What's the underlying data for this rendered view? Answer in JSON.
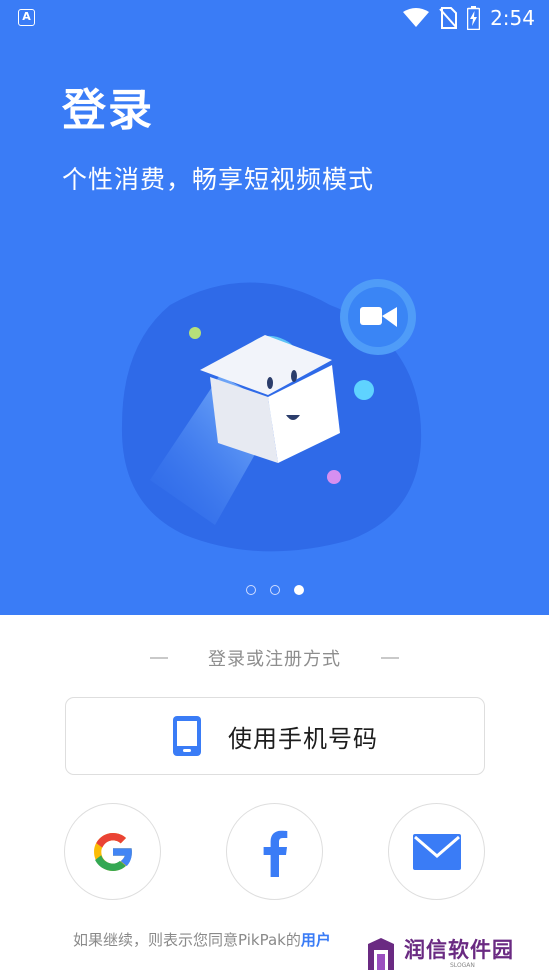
{
  "status_bar": {
    "app_letter": "A",
    "time": "2:54"
  },
  "hero": {
    "title": "登录",
    "subtitle": "个性消费，畅享短视频模式"
  },
  "carousel": {
    "page_count": 3,
    "active_index": 2
  },
  "login": {
    "divider_text": "登录或注册方式",
    "phone_button_label": "使用手机号码",
    "social_buttons": [
      "google",
      "facebook",
      "email"
    ]
  },
  "terms": {
    "text": "如果继续，则表示您同意PikPak的",
    "link_text": "用户"
  },
  "watermark": {
    "text": "润信软件园",
    "slogan": "SLOGAN"
  },
  "colors": {
    "primary_blue": "#3a7cf6",
    "google_red": "#ea4335",
    "google_yellow": "#fbbc05",
    "google_green": "#34a853",
    "google_blue": "#4285f4",
    "watermark_purple": "#6a2a82"
  }
}
